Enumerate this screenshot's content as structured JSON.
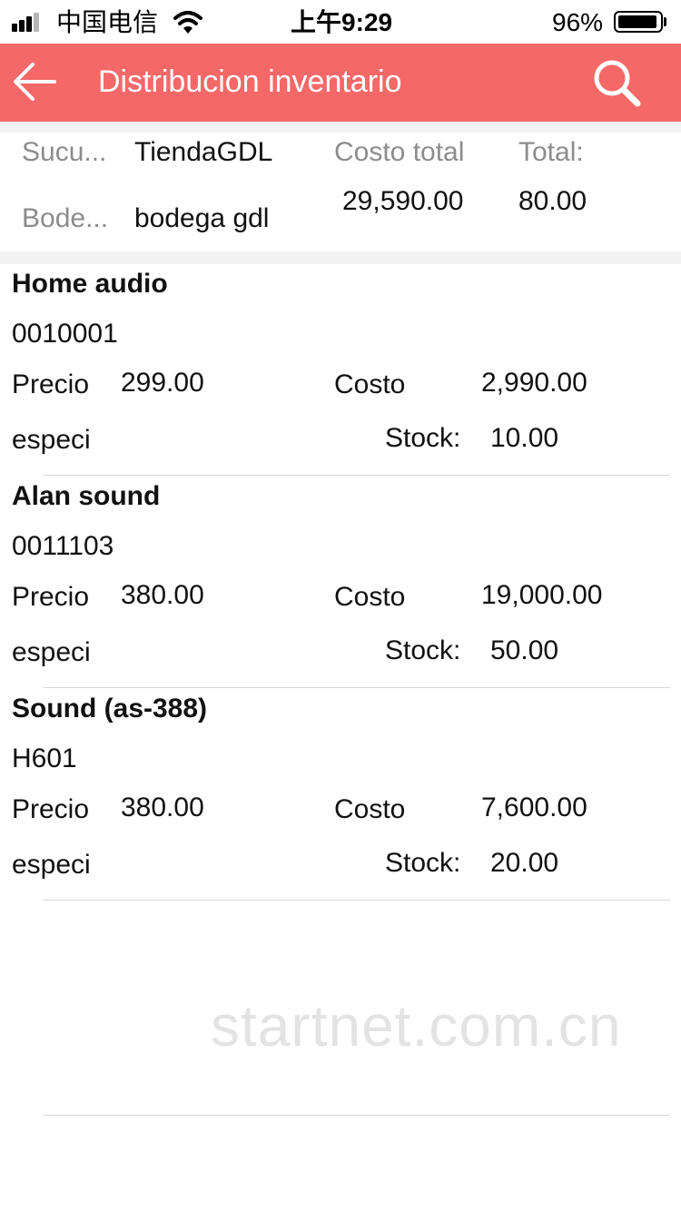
{
  "status_bar": {
    "carrier": "中国电信",
    "time": "上午9:29",
    "battery": "96%",
    "battery_level": 0.96
  },
  "nav": {
    "title": "Distribucion inventario",
    "back_icon": "arrow-left-icon",
    "search_icon": "search-icon"
  },
  "summary": {
    "branch_label": "Sucu...",
    "branch_value": "TiendaGDL",
    "warehouse_label": "Bode...",
    "warehouse_value": "bodega gdl",
    "cost_total_label": "Costo total",
    "cost_total_value": "29,590.00",
    "total_label": "Total:",
    "total_value": "80.00"
  },
  "labels": {
    "price": "Precio",
    "cost": "Costo",
    "spec": "especi",
    "stock": "Stock:"
  },
  "products": [
    {
      "name": "Home audio",
      "code": "0010001",
      "price": "299.00",
      "cost": "2,990.00",
      "stock": "10.00"
    },
    {
      "name": "Alan sound",
      "code": "0011103",
      "price": "380.00",
      "cost": "19,000.00",
      "stock": "50.00"
    },
    {
      "name": "Sound (as-388)",
      "code": "H601",
      "price": "380.00",
      "cost": "7,600.00",
      "stock": "20.00"
    }
  ],
  "watermark": "startnet.com.cn",
  "colors": {
    "nav_background": "#f56868",
    "nav_text": "#ffffff",
    "label_gray": "#8c8c8c",
    "separator": "#f2f2f2"
  }
}
